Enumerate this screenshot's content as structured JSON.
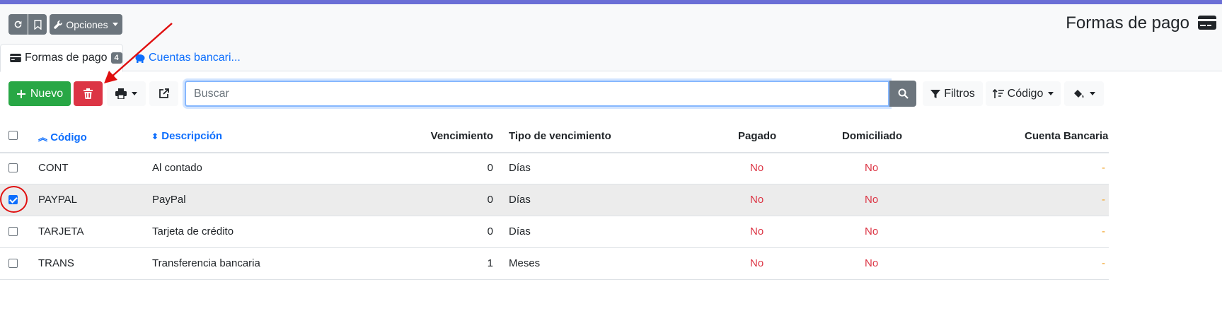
{
  "header": {
    "options_label": "Opciones",
    "title": "Formas de pago",
    "icons": {
      "refresh": "refresh-icon",
      "bookmark": "bookmark-icon",
      "wrench": "wrench-icon",
      "card": "credit-card-icon"
    }
  },
  "tabs": [
    {
      "label": "Formas de pago",
      "badge": "4",
      "icon": "credit-card-icon",
      "active": true
    },
    {
      "label": "Cuentas bancari...",
      "icon": "piggy-bank-icon",
      "active": false
    }
  ],
  "toolbar": {
    "new_label": "Nuevo",
    "filters_label": "Filtros",
    "order_label": "Código",
    "search_placeholder": "Buscar",
    "icons": {
      "add": "plus-icon",
      "delete": "trash-icon",
      "print": "print-icon",
      "export": "external-link-icon",
      "search": "search-icon",
      "filter": "filter-icon",
      "sort": "sort-icon",
      "paint": "paint-bucket-icon"
    }
  },
  "table": {
    "columns": [
      "Código",
      "Descripción",
      "Vencimiento",
      "Tipo de vencimiento",
      "Pagado",
      "Domiciliado",
      "Cuenta Bancaria"
    ],
    "rows": [
      {
        "codigo": "CONT",
        "descripcion": "Al contado",
        "vencimiento": "0",
        "tipo": "Días",
        "pagado": "No",
        "domiciliado": "No",
        "cuenta": "-",
        "checked": false
      },
      {
        "codigo": "PAYPAL",
        "descripcion": "PayPal",
        "vencimiento": "0",
        "tipo": "Días",
        "pagado": "No",
        "domiciliado": "No",
        "cuenta": "-",
        "checked": true
      },
      {
        "codigo": "TARJETA",
        "descripcion": "Tarjeta de crédito",
        "vencimiento": "0",
        "tipo": "Días",
        "pagado": "No",
        "domiciliado": "No",
        "cuenta": "-",
        "checked": false
      },
      {
        "codigo": "TRANS",
        "descripcion": "Transferencia bancaria",
        "vencimiento": "1",
        "tipo": "Meses",
        "pagado": "No",
        "domiciliado": "No",
        "cuenta": "-",
        "checked": false
      }
    ]
  },
  "colors": {
    "accent": "#0d6efd",
    "success": "#28a745",
    "danger": "#dc3545",
    "secondary": "#6c757d",
    "topbar": "#6b6fd6",
    "annotation": "#e01010"
  }
}
